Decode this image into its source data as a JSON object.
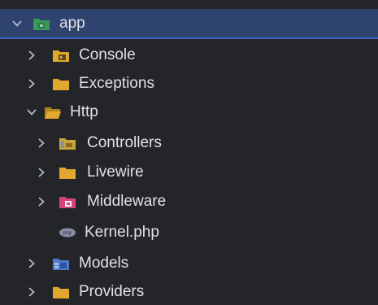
{
  "tree": {
    "items": [
      {
        "label": "app",
        "icon": "module-folder-icon",
        "expanded": true,
        "selected": true,
        "color": "#3a9a5b"
      },
      {
        "label": "Console",
        "icon": "console-folder-icon",
        "expanded": false,
        "color": "#e0a82e"
      },
      {
        "label": "Exceptions",
        "icon": "folder-icon",
        "expanded": false,
        "color": "#e0a82e"
      },
      {
        "label": "Http",
        "icon": "folder-open-icon",
        "expanded": true,
        "color": "#e0a82e"
      },
      {
        "label": "Controllers",
        "icon": "controllers-folder-icon",
        "expanded": false,
        "color": "#c9a53c"
      },
      {
        "label": "Livewire",
        "icon": "folder-icon",
        "expanded": false,
        "color": "#e0a82e"
      },
      {
        "label": "Middleware",
        "icon": "middleware-folder-icon",
        "expanded": false,
        "color": "#d6457a"
      },
      {
        "label": "Kernel.php",
        "icon": "php-file-icon",
        "color": "#8a8fa8"
      },
      {
        "label": "Models",
        "icon": "models-folder-icon",
        "expanded": false,
        "color": "#4d79c9"
      },
      {
        "label": "Providers",
        "icon": "folder-icon",
        "expanded": false,
        "color": "#e0a82e"
      }
    ]
  },
  "colors": {
    "background": "#232528",
    "selection": "#2e436e",
    "selection_border": "#3c65c4",
    "text": "#dfe1e5",
    "chevron": "#b4b8bf"
  }
}
